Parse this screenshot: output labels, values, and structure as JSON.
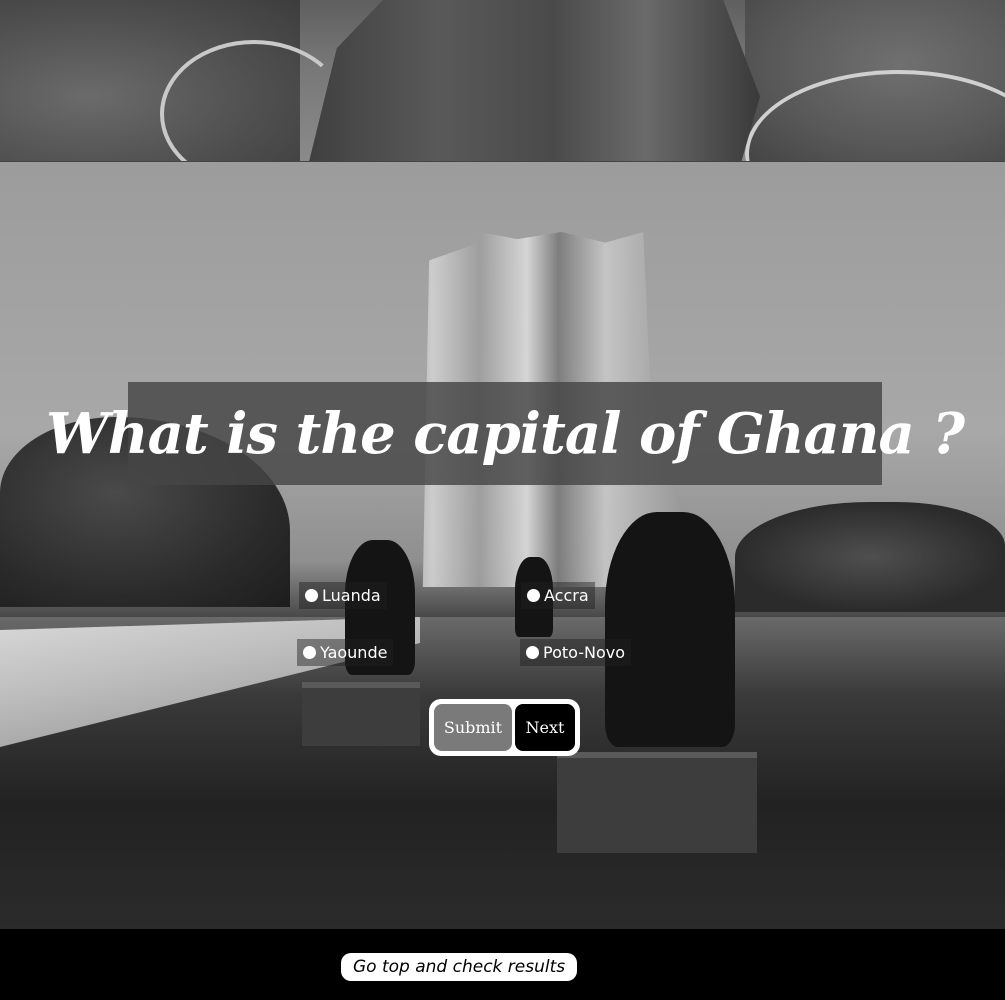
{
  "quiz": {
    "question": "What is the capital of Ghana ?",
    "options": [
      "Luanda",
      "Accra",
      "Yaounde",
      "Poto-Novo"
    ],
    "submit_label": "Submit",
    "next_label": "Next"
  },
  "footer": {
    "results_link": "Go top and check results"
  },
  "colors": {
    "question_bg": "#464646",
    "submit_bg": "#7a7a7a",
    "next_bg": "#000000",
    "footer_bg": "#000000"
  }
}
